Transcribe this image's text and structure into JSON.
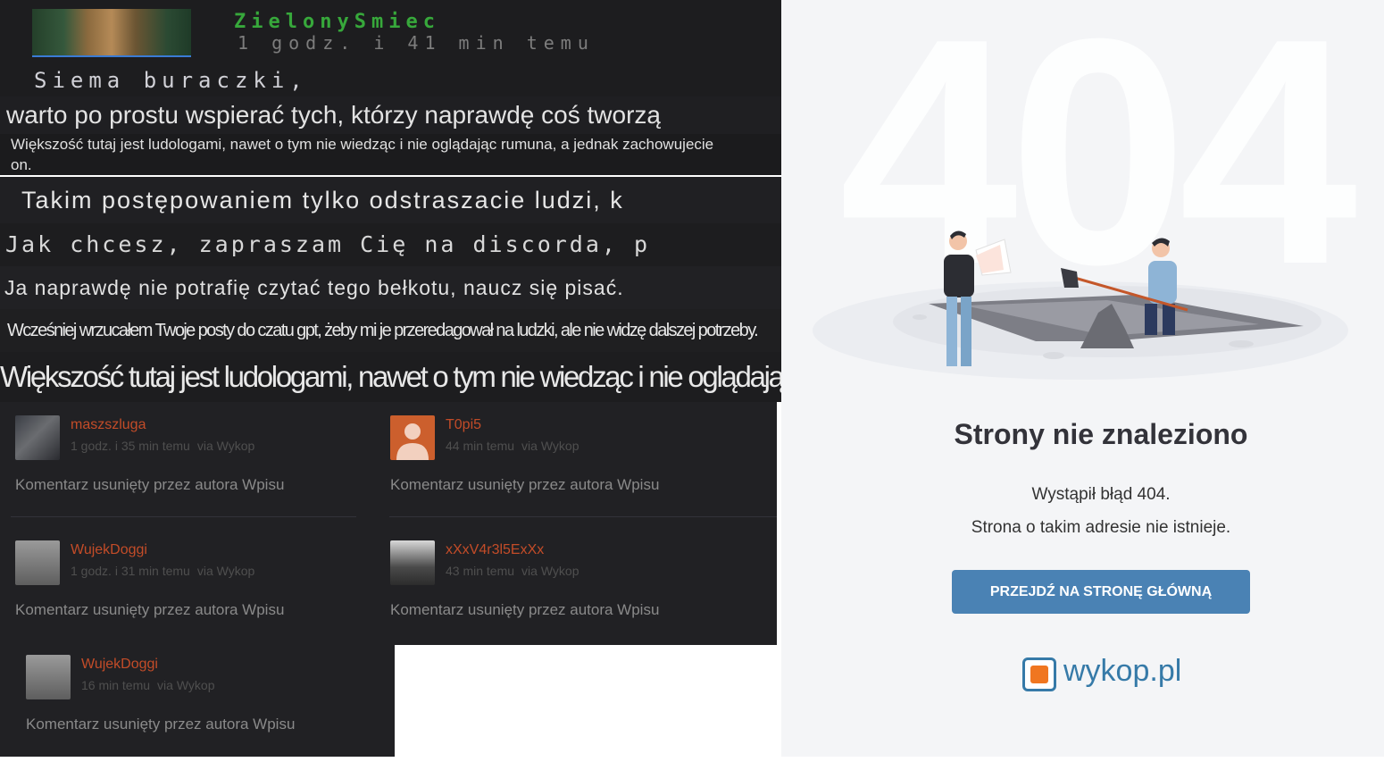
{
  "post": {
    "author": "ZielonySmiec",
    "time": "1 godz. i 41 min temu",
    "lines": [
      "Siema buraczki,",
      "warto po prostu wspierać tych, którzy naprawdę coś tworzą",
      "Większość tutaj jest ludologami, nawet o tym nie wiedząc i nie oglądając rumuna, a jednak zachowujecie",
      "on.",
      "Takim postępowaniem tylko odstraszacie ludzi, k",
      "Jak chcesz, zapraszam Cię na discorda, p",
      "Ja naprawdę nie potrafię czytać tego bełkotu, naucz się pisać.",
      "Wcześniej wrzucałem Twoje posty do czatu gpt, żeby mi je przeredagował na ludzki, ale nie widzę dalszej potrzeby.",
      "Większość tutaj jest ludologami, nawet o tym nie wiedząc i nie oglądając rumuna,"
    ]
  },
  "comments": [
    {
      "nick": "maszszluga",
      "time": "1 godz. i 35 min temu",
      "via": "via Wykop",
      "text": "Komentarz usunięty przez autora Wpisu"
    },
    {
      "nick": "T0pi5",
      "time": "44 min temu",
      "via": "via Wykop",
      "text": "Komentarz usunięty przez autora Wpisu"
    },
    {
      "nick": "WujekDoggi",
      "time": "1 godz. i 31 min temu",
      "via": "via Wykop",
      "text": "Komentarz usunięty przez autora Wpisu"
    },
    {
      "nick": "xXxV4r3l5ExXx",
      "time": "43 min temu",
      "via": "via Wykop",
      "text": "Komentarz usunięty przez autora Wpisu"
    },
    {
      "nick": "WujekDoggi",
      "time": "16 min temu",
      "via": "via Wykop",
      "text": "Komentarz usunięty przez autora Wpisu"
    }
  ],
  "error_page": {
    "code": "404",
    "title": "Strony nie znaleziono",
    "line1": "Wystąpił błąd 404.",
    "line2": "Strona o takim adresie nie istnieje.",
    "button": "PRZEJDŹ NA STRONĘ GŁÓWNĄ",
    "logo_text": "wykop.pl"
  },
  "colors": {
    "nick": "#c34c28",
    "author": "#37a83b",
    "button": "#4a82b4",
    "brand_blue": "#367aa8",
    "brand_orange": "#f07620"
  }
}
